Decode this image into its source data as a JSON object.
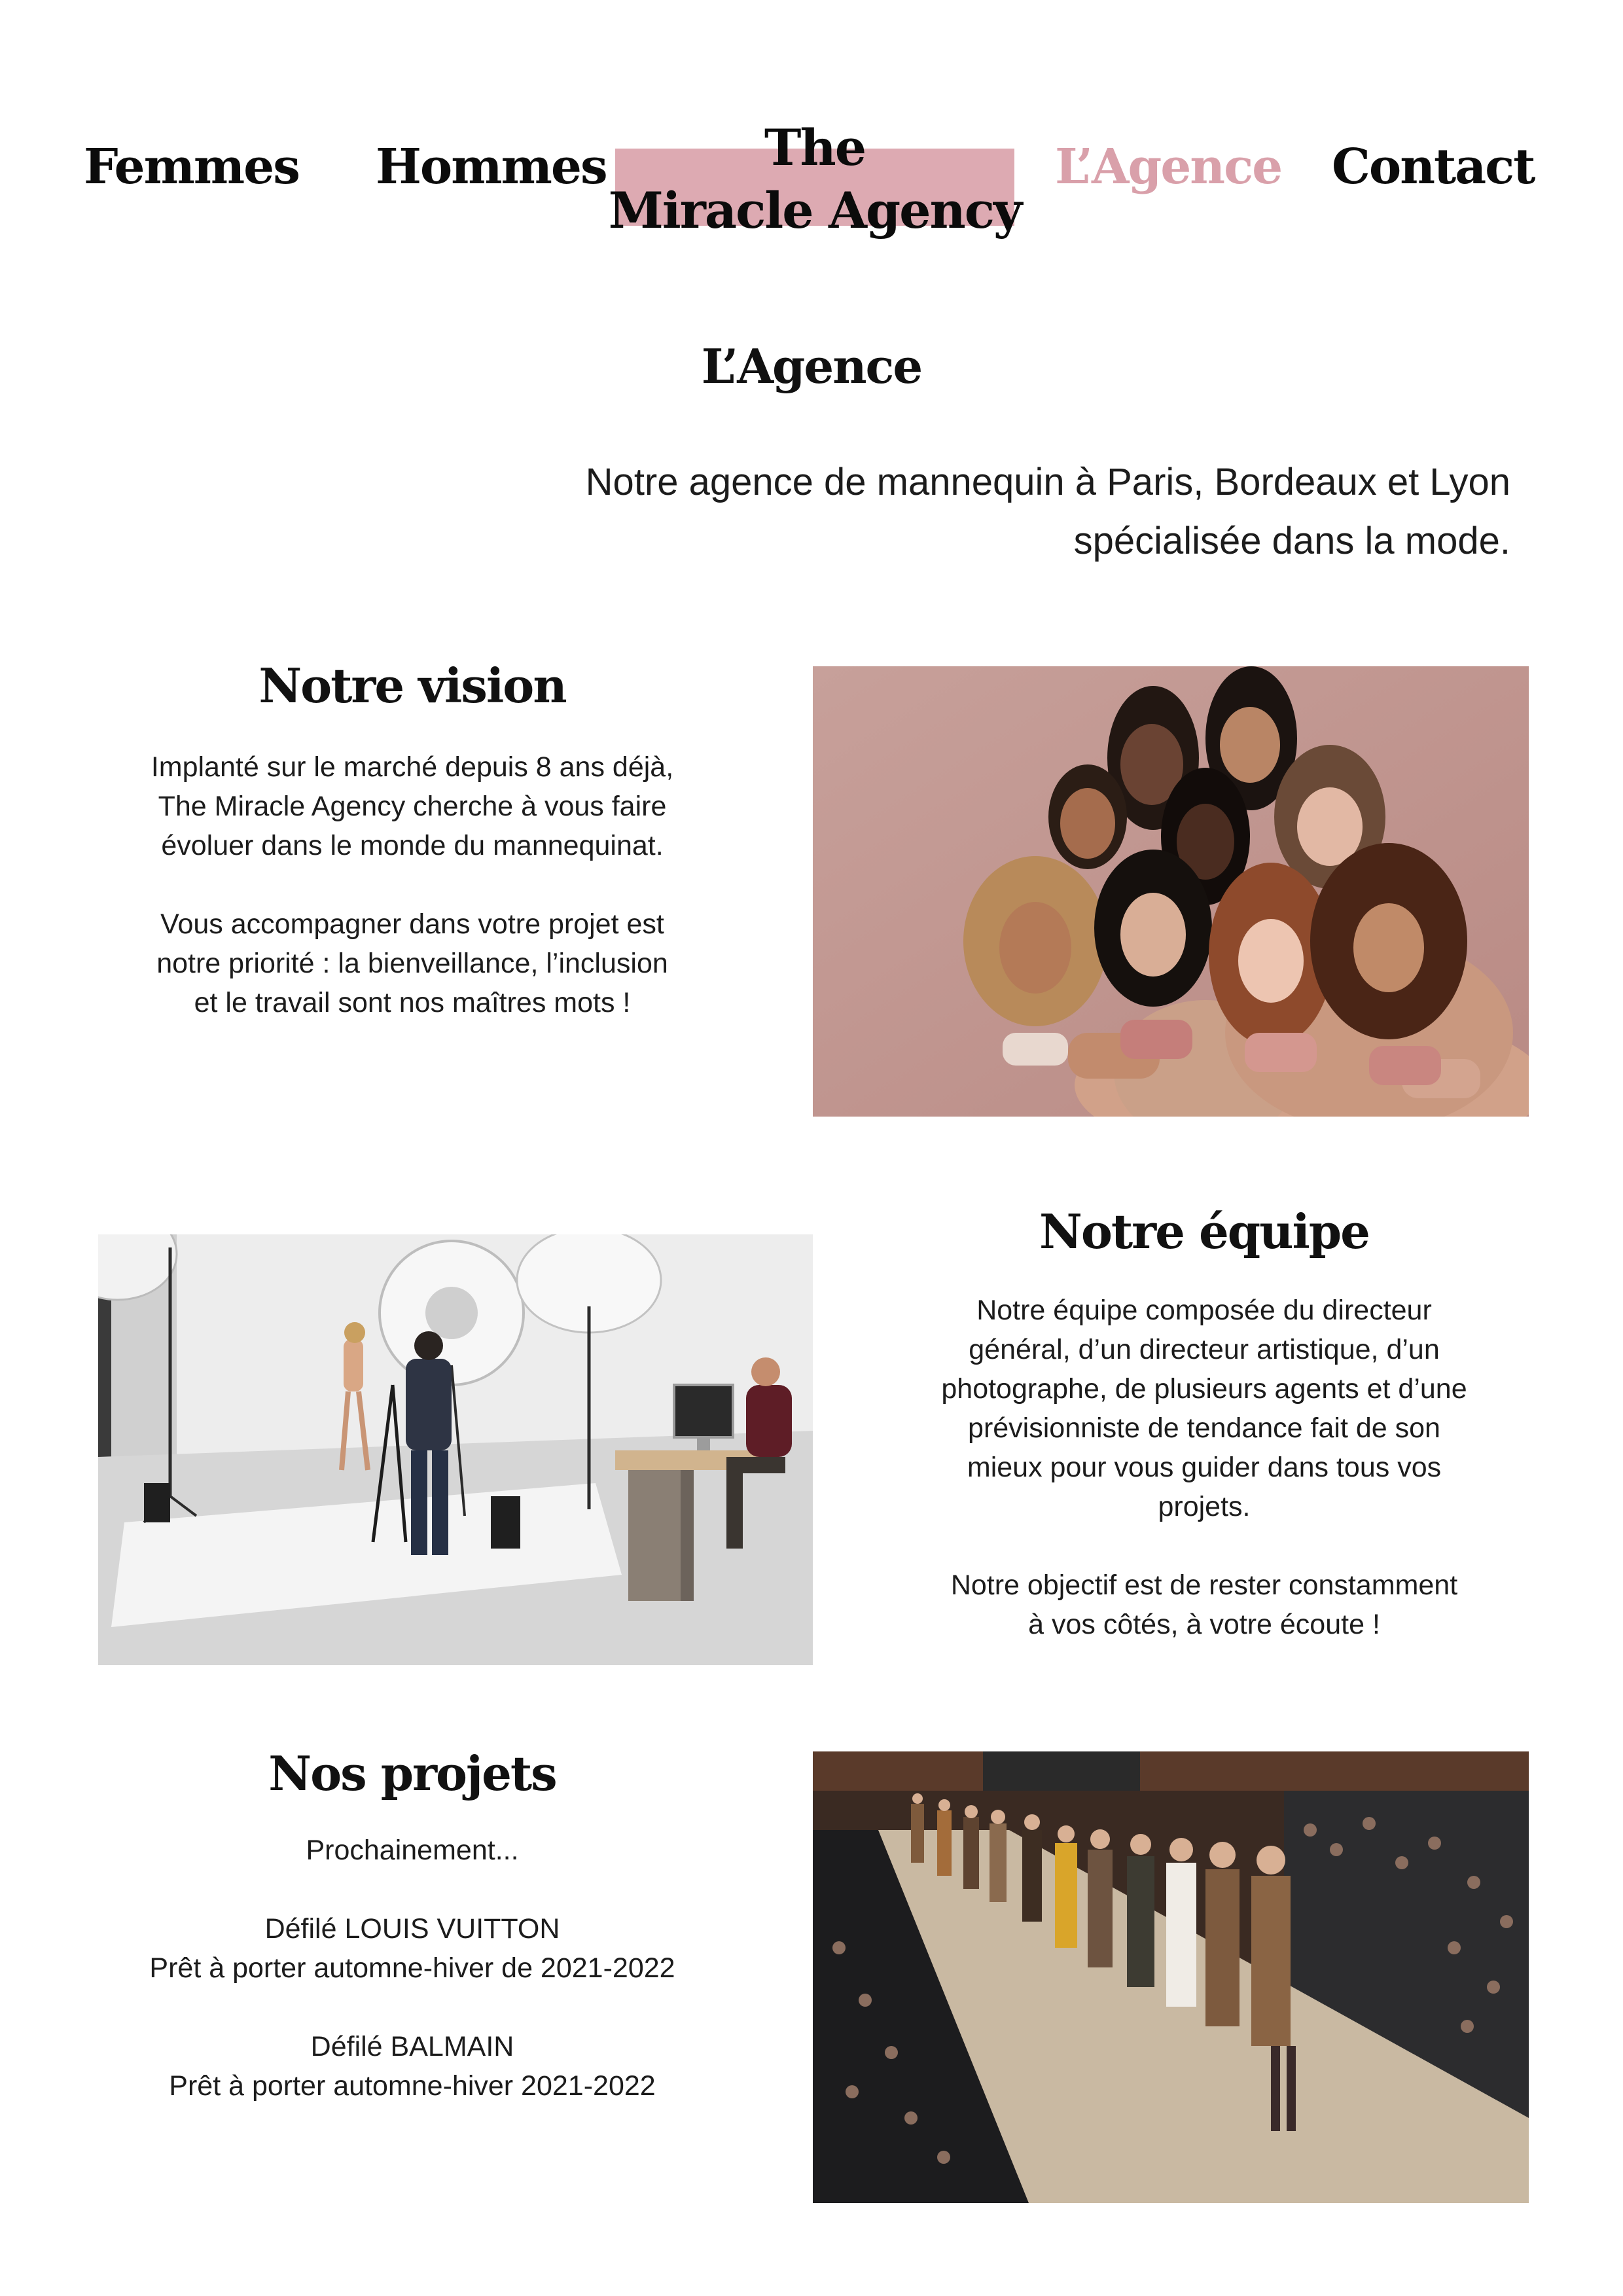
{
  "nav": {
    "items": [
      {
        "label": "Femmes",
        "active": false
      },
      {
        "label": "Hommes",
        "active": false
      },
      {
        "label": "L’Agence",
        "active": true
      },
      {
        "label": "Contact",
        "active": false
      }
    ],
    "logo_line1": "The",
    "logo_line2": "Miracle Agency",
    "active_color": "#d9a0aa",
    "logo_bg_color": "#ddaab2"
  },
  "page": {
    "title": "L’Agence",
    "tagline_line1": "Notre agence de mannequin à Paris, Bordeaux et Lyon",
    "tagline_line2": "spécialisée dans la mode."
  },
  "vision": {
    "title": "Notre vision",
    "paragraph1": [
      "Implanté sur le marché depuis 8 ans déjà,",
      "The Miracle Agency cherche à vous faire",
      "évoluer dans le monde du mannequinat."
    ],
    "paragraph2": [
      "Vous accompagner dans votre projet est",
      "notre priorité : la bienveillance, l’inclusion",
      "et le travail sont nos maîtres mots !"
    ]
  },
  "equipe": {
    "title": "Notre équipe",
    "paragraph1": [
      "Notre équipe composée du directeur",
      "général, d’un directeur artistique, d’un",
      "photographe, de plusieurs agents et d’une",
      "prévisionniste de tendance fait de son",
      "mieux pour vous guider dans tous vos",
      "projets."
    ],
    "paragraph2": [
      "Notre objectif est de rester constamment",
      "à vos côtés, à votre écoute !"
    ]
  },
  "projets": {
    "title": "Nos projets",
    "intro": "Prochainement...",
    "show1_name": "Défilé LOUIS VUITTON",
    "show1_detail": "Prêt à porter automne-hiver de 2021-2022",
    "show2_name": "Défilé BALMAIN",
    "show2_detail": "Prêt à porter automne-hiver 2021-2022"
  },
  "images": {
    "models": "group-of-models-photo",
    "studio": "photo-studio-shoot-photo",
    "runway": "fashion-runway-show-photo"
  }
}
